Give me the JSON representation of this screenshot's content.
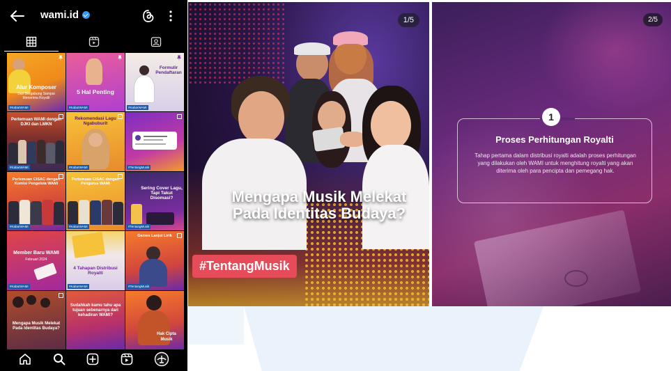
{
  "profile": {
    "username": "wami.id",
    "verified": true
  },
  "icons": {
    "back": "back-arrow-icon",
    "threads": "threads-icon",
    "more": "more-vertical-icon",
    "grid_tab": "grid-icon",
    "reels_tab": "reels-icon",
    "tagged_tab": "tagged-icon",
    "home": "home-icon",
    "search": "search-icon",
    "create": "create-icon",
    "reels": "reels-icon",
    "profile": "profile-icon"
  },
  "grid_posts": [
    {
      "caption": "Alur Komposer",
      "subcaption": "Dari Bergabung Sampai Menerima Royalti",
      "tag": "#KabarWAMI",
      "style": "t-yellow",
      "pinned": true
    },
    {
      "caption": "5 Hal Penting",
      "subcaption": "",
      "tag": "#KabarWAMI",
      "style": "t-pinkp",
      "pinned": true
    },
    {
      "caption": "Formulir Pendaftaran",
      "subcaption": "",
      "tag": "#KabarWAMI",
      "style": "t-light",
      "pinned": true
    },
    {
      "caption": "Pertemuan WAMI dengan DJKI dan LMKN",
      "subcaption": "",
      "tag": "#KabarWAMI",
      "style": "t-group",
      "pinned": false
    },
    {
      "caption": "Rekomendasi Lagu Ngabuburit",
      "subcaption": "",
      "tag": "#KabarWAMI",
      "style": "t-gold",
      "pinned": false
    },
    {
      "caption": "",
      "subcaption": "",
      "tag": "#TentangMusik",
      "style": "t-purple",
      "pinned": false
    },
    {
      "caption": "Pertemuan CISAC dengan Komisi Pengelola WAMI",
      "subcaption": "",
      "tag": "#KabarWAMI",
      "style": "t-orange",
      "pinned": false
    },
    {
      "caption": "Pertemuan CISAC dengan Pengurus WAMI",
      "subcaption": "",
      "tag": "#KabarWAMI",
      "style": "t-gold",
      "pinned": false
    },
    {
      "caption": "Sering Cover Lagu, Tapi Takut Disomasi?",
      "subcaption": "",
      "tag": "#TentangMusik",
      "style": "t-dark",
      "pinned": false
    },
    {
      "caption": "Member Baru WAMI",
      "subcaption": "Februari 2024",
      "tag": "#KabarWAMI",
      "style": "t-red",
      "pinned": false
    },
    {
      "caption": "4 Tahapan Distribusi Royalti",
      "subcaption": "",
      "tag": "#KabarWAMI",
      "style": "t-light",
      "pinned": false
    },
    {
      "caption": "Games Lanjut Lirik",
      "subcaption": "",
      "tag": "#TentangMusik",
      "style": "t-orange",
      "pinned": false
    },
    {
      "caption": "Mengapa Musik Melekat Pada Identitas Budaya?",
      "subcaption": "",
      "tag": "",
      "style": "t-brown",
      "pinned": false
    },
    {
      "caption": "Sudahkah kamu tahu apa tujuan sebenarnya dari kehadiran WAMI?",
      "subcaption": "",
      "tag": "",
      "style": "t-red",
      "pinned": false
    },
    {
      "caption": "Hak Cipta Musik",
      "subcaption": "",
      "tag": "",
      "style": "t-orange",
      "pinned": false
    }
  ],
  "slide1": {
    "counter": "1/5",
    "headline": "Mengapa Musik Melekat Pada Identitas Budaya?",
    "hashtag": "#TentangMusik"
  },
  "slide2": {
    "counter": "2/5",
    "step": "1",
    "title": "Proses Perhitungan Royalti",
    "body": "Tahap pertama dalam distribusi royalti adalah proses perhitungan yang dilakukan oleh WAMI untuk menghitung royalti yang akan diterima oleh para pencipta dan pemegang hak."
  }
}
